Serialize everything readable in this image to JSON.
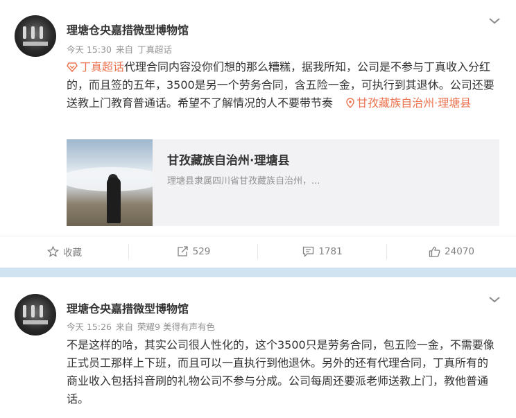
{
  "posts": [
    {
      "author": "理塘仓央嘉措微型博物馆",
      "time": "今天 15:30",
      "source_prefix": "来自",
      "source": "丁真超话",
      "content": {
        "topic": "丁真超话",
        "text": "代理合同内容没你们想的那么糟糕，据我所知，公司是不参与丁真收入分红的，而且签的五年，3500是另一个劳务合同，含五险一金，可执行到其退休。公司还要送教上门教育普通话。希望不了解情况的人不要带节奏",
        "location": "甘孜藏族自治州·理塘县"
      },
      "card": {
        "title": "甘孜藏族自治州·理塘县",
        "subtitle": "理塘县隶属四川省甘孜藏族自治州，..."
      },
      "actions": {
        "favorite": "收藏",
        "repost": "529",
        "comment": "1781",
        "like": "24070"
      }
    },
    {
      "author": "理塘仓央嘉措微型博物馆",
      "time": "今天 15:26",
      "source_prefix": "来自",
      "source": "荣耀9 美得有声有色",
      "content": {
        "text": "不是这样的哈，其实公司很人性化的，这个3500只是劳务合同，包五险一金，不需要像正式员工那样上下班，而且可以一直执行到他退休。另外的还有代理合同，丁真所有的商业收入包括抖音刷的礼物公司不参与分成。公司每周还要派老师送教上门，教他普通话。"
      }
    }
  ],
  "colors": {
    "link": "#eb7350",
    "divider": "#cfe3f1",
    "meta": "#939393"
  }
}
